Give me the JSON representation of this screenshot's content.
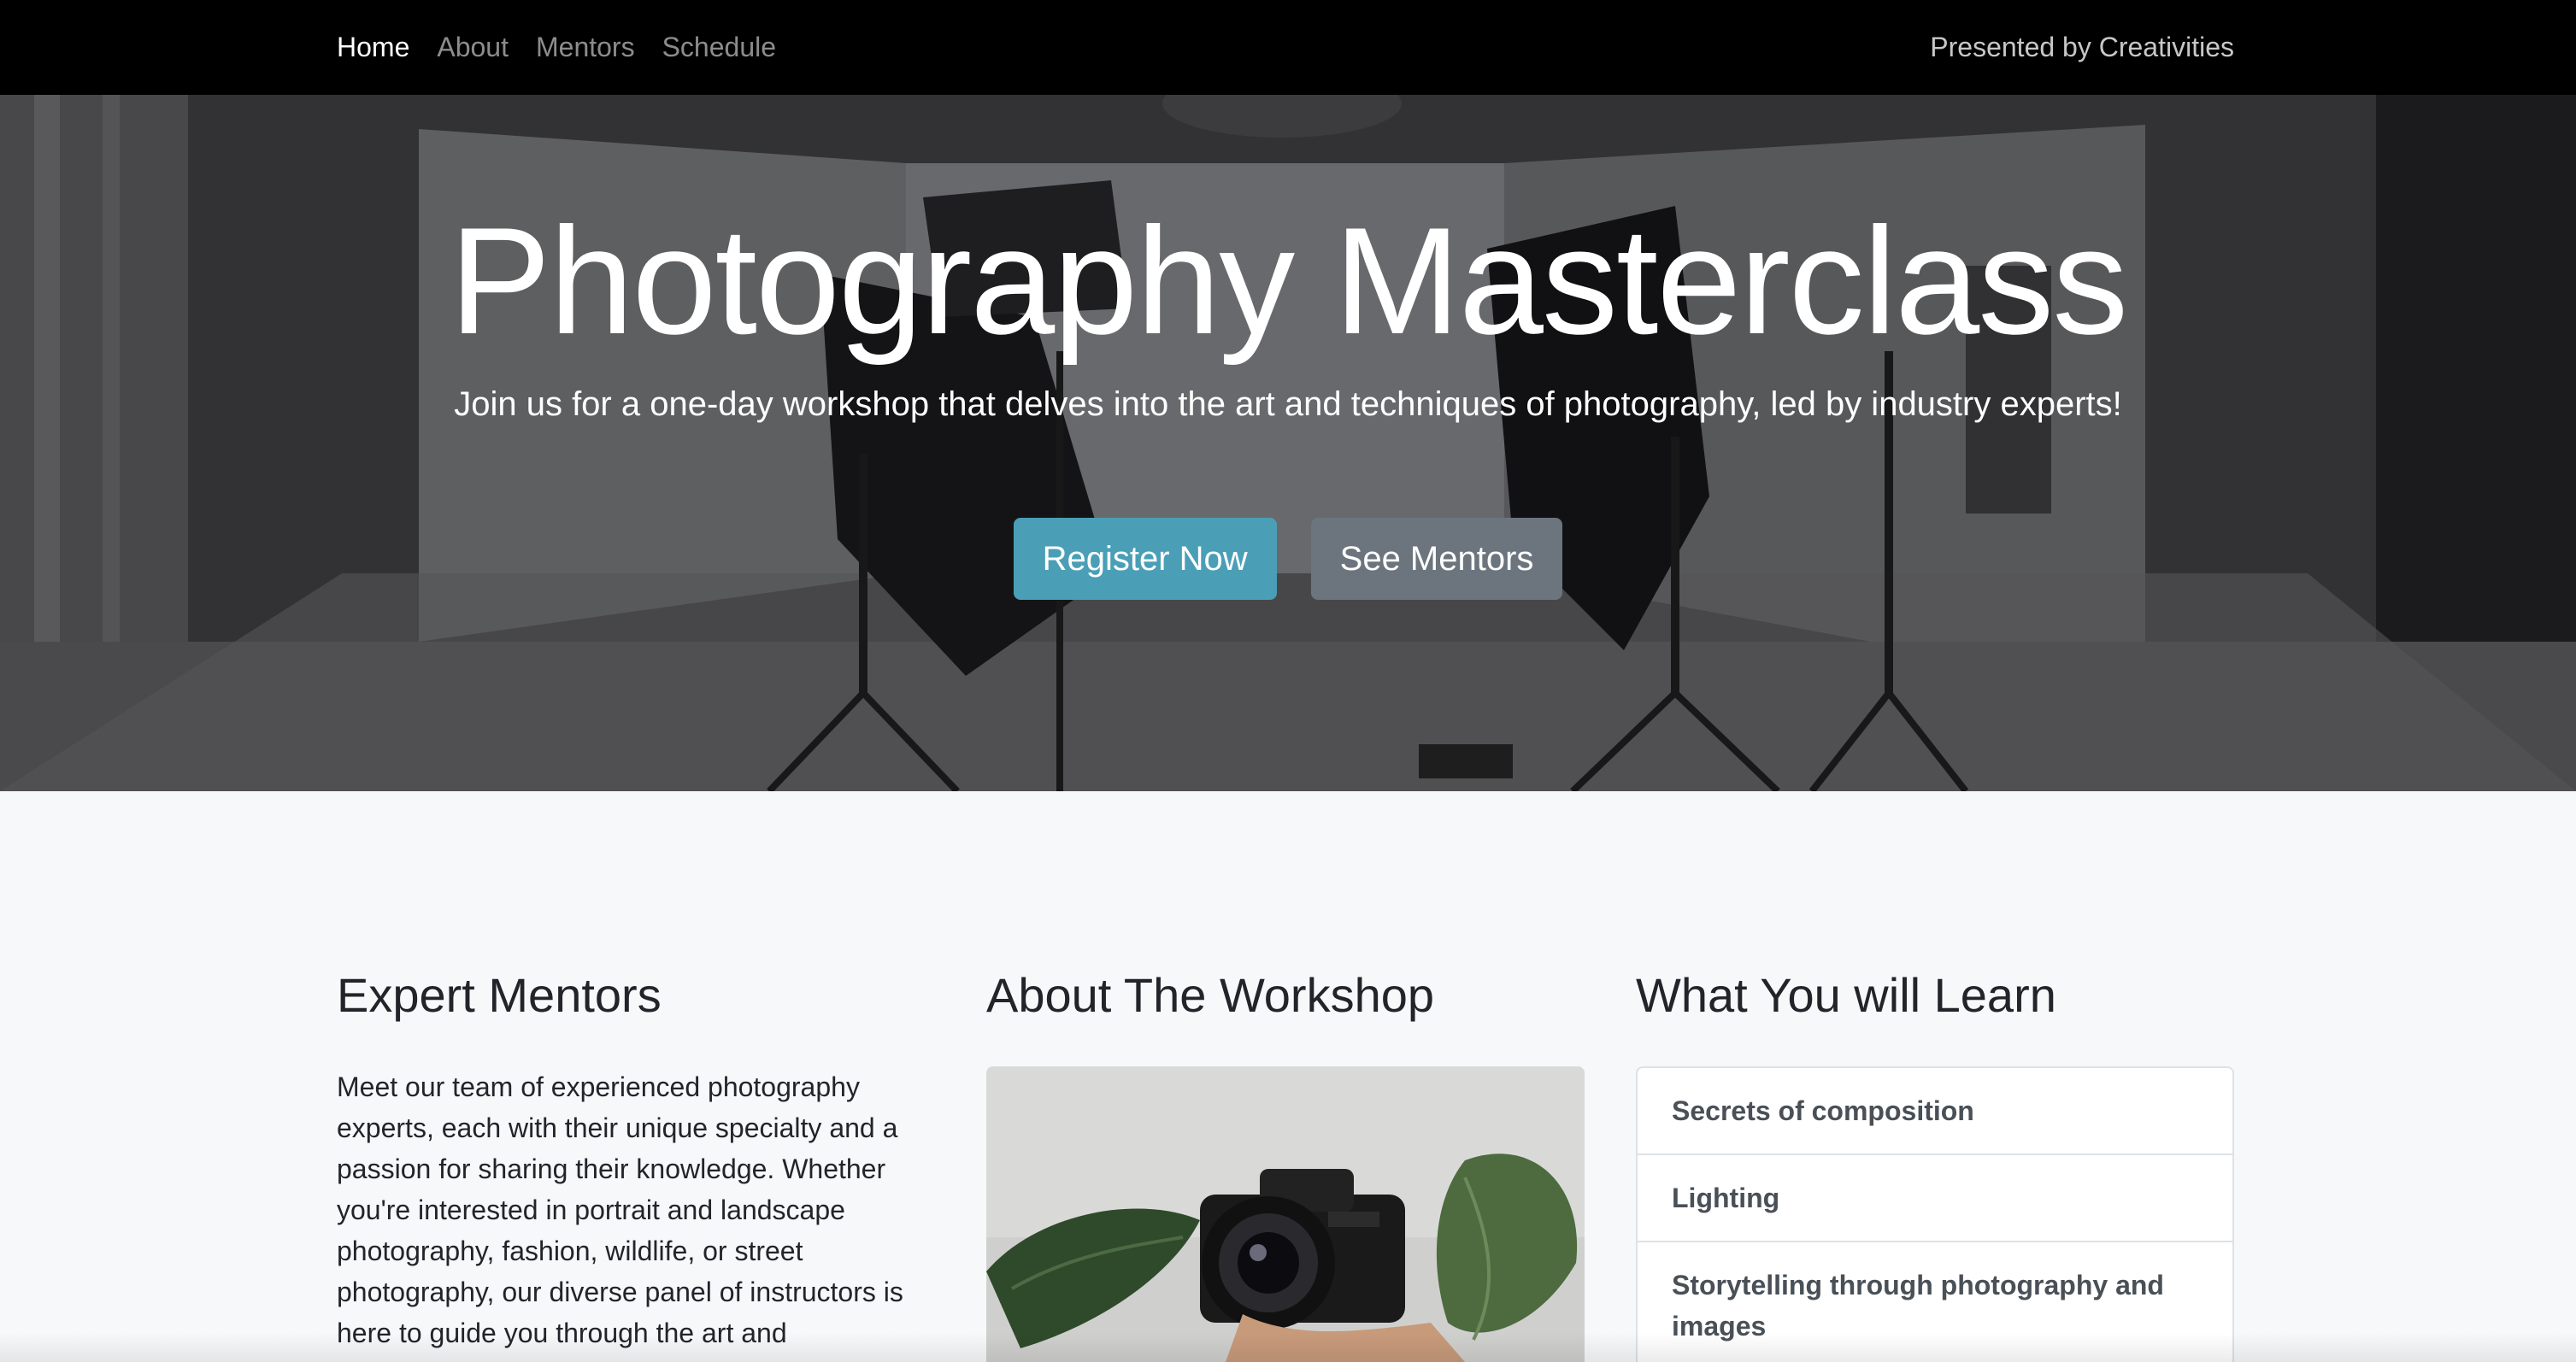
{
  "nav": {
    "links": [
      {
        "label": "Home",
        "active": true
      },
      {
        "label": "About",
        "active": false
      },
      {
        "label": "Mentors",
        "active": false
      },
      {
        "label": "Schedule",
        "active": false
      }
    ],
    "brand": "Presented by Creativities"
  },
  "hero": {
    "title": "Photography Masterclass",
    "subtitle": "Join us for a one-day workshop that delves into the art and techniques of photography, led by industry experts!",
    "primary_button": "Register Now",
    "secondary_button": "See Mentors"
  },
  "sections": {
    "mentors": {
      "title": "Expert Mentors",
      "text": "Meet our team of experienced photography experts, each with their unique specialty and a passion for sharing their knowledge. Whether you're interested in portrait and landscape photography, fashion, wildlife, or street photography, our diverse panel of instructors is here to guide you through the art and"
    },
    "workshop": {
      "title": "About The Workshop"
    },
    "learn": {
      "title": "What You will Learn",
      "items": [
        "Secrets of composition",
        "Lighting",
        "Storytelling through photography and images"
      ]
    }
  },
  "colors": {
    "navbar": "#000000",
    "primary": "#4a9fb7",
    "secondary": "#6c757d",
    "page_bg": "#f7f8fa"
  }
}
